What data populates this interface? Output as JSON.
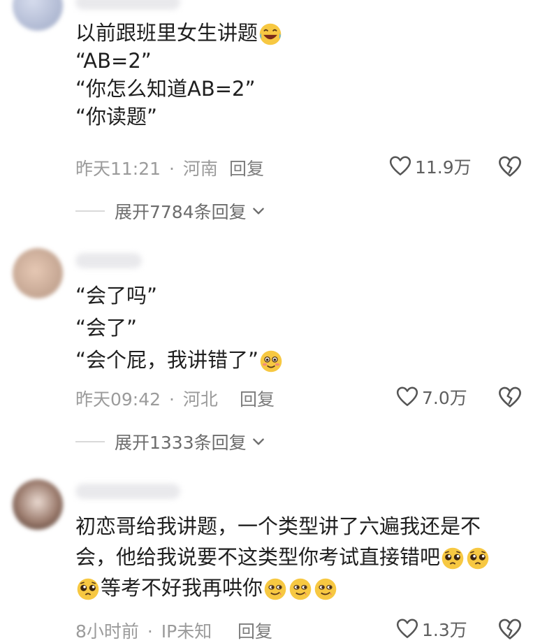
{
  "comments": [
    {
      "lines": [
        "以前跟班里女生讲题",
        "“AB=2”",
        "“你怎么知道AB=2”",
        "“你读题”"
      ],
      "time": "昨天11:21",
      "sep": "·",
      "location": "河南",
      "reply_label": "回复",
      "likes": "11.9万",
      "expand_label": "展开7784条回复",
      "emoji": "laughing-crying-emoji"
    },
    {
      "lines": [
        "“会了吗”",
        "“会了”",
        "“会个屁，我讲错了”"
      ],
      "time": "昨天09:42",
      "sep": "·",
      "location": "河北",
      "reply_label": "回复",
      "likes": "7.0万",
      "expand_label": "展开1333条回复",
      "emoji": "flushed-smile-emoji"
    },
    {
      "lines": [
        "初恋哥给我讲题，一个类型讲了六遍我还是不",
        "会，他给我说要不这类型你考试直接错吧",
        "等考不好我再哄你"
      ],
      "time": "8小时前",
      "sep": "·",
      "location": "IP未知",
      "reply_label": "回复",
      "likes": "1.3万",
      "emoji": "pleading-face-emoji, sly-smile-emoji"
    }
  ],
  "icons": {
    "like": "heart-outline-icon",
    "dislike": "broken-heart-icon",
    "expand": "chevron-down-icon"
  },
  "colors": {
    "text": "#1f1f1f",
    "meta": "#9b9b9b",
    "emoji_yellow": "#f7c842"
  }
}
